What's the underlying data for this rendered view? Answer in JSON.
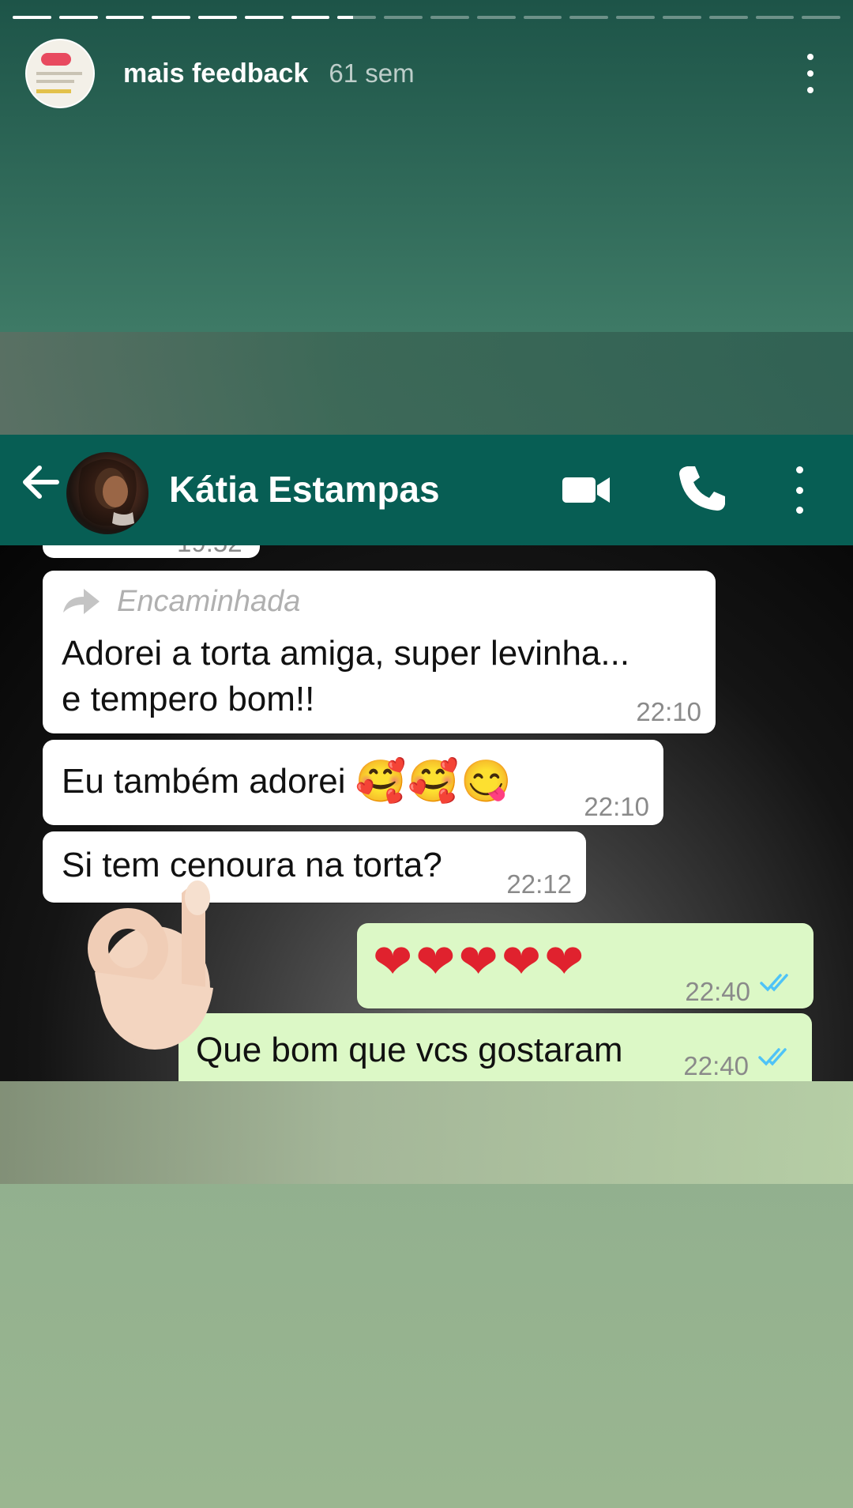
{
  "story": {
    "segments_total": 18,
    "segments_done": 7,
    "current_segment_progress": 0.4,
    "username": "mais feedback",
    "time_ago": "61 sem"
  },
  "whatsapp": {
    "contact_name": "Kátia Estampas",
    "partial_top_time": "19:52",
    "messages": [
      {
        "direction": "in",
        "forwarded_label": "Encaminhada",
        "text_line1": "Adorei a torta amiga, super levinha...",
        "text_line2": "e tempero bom!!",
        "time": "22:10"
      },
      {
        "direction": "in",
        "text": "Eu também adorei",
        "emojis": "🥰🥰😋",
        "time": "22:10"
      },
      {
        "direction": "in",
        "text": "Si tem cenoura na torta?",
        "time": "22:12"
      },
      {
        "direction": "out",
        "text": "❤❤❤❤❤",
        "time": "22:40",
        "status": "read"
      },
      {
        "direction": "out",
        "text": "Que bom que vcs gostaram",
        "time": "22:40",
        "status": "read"
      }
    ]
  },
  "colors": {
    "wa_header": "#075e54",
    "bubble_out": "#dcf8c6",
    "read_ticks": "#4fc3f7",
    "heart": "#e0222e"
  }
}
